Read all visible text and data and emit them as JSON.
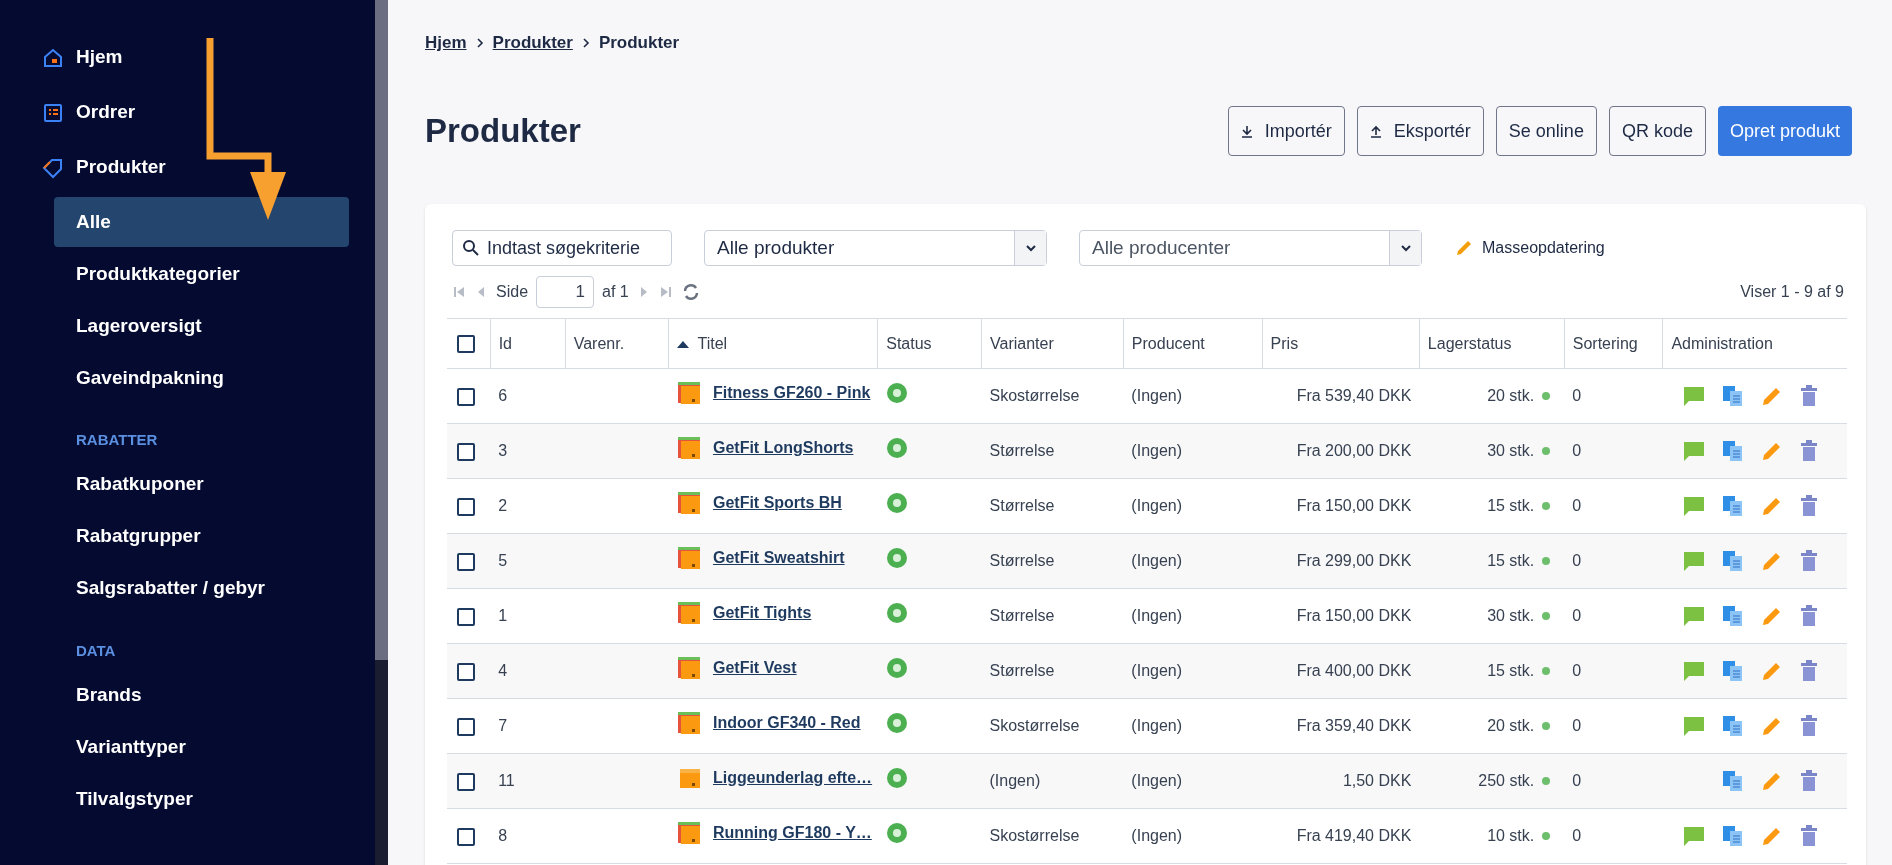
{
  "sidebar": {
    "items": [
      {
        "label": "Hjem",
        "kind": "top",
        "selected": false
      },
      {
        "label": "Ordrer",
        "kind": "top",
        "selected": false
      },
      {
        "label": "Produkter",
        "kind": "top",
        "selected": false
      },
      {
        "label": "Alle",
        "kind": "sub",
        "selected": true
      },
      {
        "label": "Produktkategorier",
        "kind": "sub",
        "selected": false
      },
      {
        "label": "Lageroversigt",
        "kind": "sub",
        "selected": false
      },
      {
        "label": "Gaveindpakning",
        "kind": "sub",
        "selected": false
      },
      {
        "label": "RABATTER",
        "kind": "heading"
      },
      {
        "label": "Rabatkuponer",
        "kind": "sub",
        "selected": false
      },
      {
        "label": "Rabatgrupper",
        "kind": "sub",
        "selected": false
      },
      {
        "label": "Salgsrabatter / gebyr",
        "kind": "sub",
        "selected": false
      },
      {
        "label": "DATA",
        "kind": "heading"
      },
      {
        "label": "Brands",
        "kind": "sub",
        "selected": false
      },
      {
        "label": "Varianttyper",
        "kind": "sub",
        "selected": false
      },
      {
        "label": "Tilvalgstyper",
        "kind": "sub",
        "selected": false
      }
    ]
  },
  "breadcrumb": [
    "Hjem",
    "Produkter",
    "Produkter"
  ],
  "title": "Produkter",
  "actions": [
    {
      "label": "Importér",
      "kind": "download"
    },
    {
      "label": "Eksportér",
      "kind": "upload"
    },
    {
      "label": "Se online",
      "kind": "plain"
    },
    {
      "label": "QR kode",
      "kind": "plain"
    },
    {
      "label": "Opret produkt",
      "kind": "primary"
    }
  ],
  "filters": {
    "search": {
      "placeholder": "Indtast søgekriterie"
    },
    "product_select": "Alle produkter",
    "producer_select": "Alle producenter",
    "bulk_update": "Masseopdatering"
  },
  "pager": {
    "page_label": "Side",
    "page": "1",
    "of": "af 1",
    "summary": "Viser 1 - 9 af 9"
  },
  "table": {
    "all_checked": false,
    "columns": [
      "Id",
      "Varenr.",
      "Titel",
      "Status",
      "Varianter",
      "Producent",
      "Pris",
      "Lagerstatus",
      "Sortering",
      "Administration"
    ],
    "rows": [
      {
        "id": "6",
        "title": "Fitness GF260 - Pink",
        "variants": "Skostørrelse",
        "producer": "(Ingen)",
        "price": "Fra 539,40 DKK",
        "stock": "20 stk.",
        "sort": "0",
        "kind": "stack",
        "comment": true,
        "checked": false
      },
      {
        "id": "3",
        "title": "GetFit LongShorts",
        "variants": "Størrelse",
        "producer": "(Ingen)",
        "price": "Fra 200,00 DKK",
        "stock": "30 stk.",
        "sort": "0",
        "kind": "stack",
        "comment": true,
        "checked": false
      },
      {
        "id": "2",
        "title": "GetFit Sports BH",
        "variants": "Størrelse",
        "producer": "(Ingen)",
        "price": "Fra 150,00 DKK",
        "stock": "15 stk.",
        "sort": "0",
        "kind": "stack",
        "comment": true,
        "checked": false
      },
      {
        "id": "5",
        "title": "GetFit Sweatshirt",
        "variants": "Størrelse",
        "producer": "(Ingen)",
        "price": "Fra 299,00 DKK",
        "stock": "15 stk.",
        "sort": "0",
        "kind": "stack",
        "comment": true,
        "checked": false
      },
      {
        "id": "1",
        "title": "GetFit Tights",
        "variants": "Størrelse",
        "producer": "(Ingen)",
        "price": "Fra 150,00 DKK",
        "stock": "30 stk.",
        "sort": "0",
        "kind": "stack",
        "comment": true,
        "checked": false
      },
      {
        "id": "4",
        "title": "GetFit Vest",
        "variants": "Størrelse",
        "producer": "(Ingen)",
        "price": "Fra 400,00 DKK",
        "stock": "15 stk.",
        "sort": "0",
        "kind": "stack",
        "comment": true,
        "checked": false
      },
      {
        "id": "7",
        "title": "Indoor GF340 - Red",
        "variants": "Skostørrelse",
        "producer": "(Ingen)",
        "price": "Fra 359,40 DKK",
        "stock": "20 stk.",
        "sort": "0",
        "kind": "stack",
        "comment": true,
        "checked": false
      },
      {
        "id": "11",
        "title": "Liggeunderlag efte…",
        "variants": "(Ingen)",
        "producer": "(Ingen)",
        "price": "1,50 DKK",
        "stock": "250 stk.",
        "sort": "0",
        "kind": "box",
        "comment": false,
        "checked": false
      },
      {
        "id": "8",
        "title": "Running GF180 - Y…",
        "variants": "Skostørrelse",
        "producer": "(Ingen)",
        "price": "Fra 419,40 DKK",
        "stock": "10 stk.",
        "sort": "0",
        "kind": "stack",
        "comment": true,
        "checked": false
      }
    ]
  }
}
